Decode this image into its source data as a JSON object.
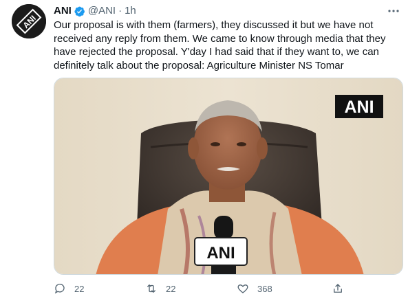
{
  "tweet": {
    "author_name": "ANI",
    "handle": "@ANI",
    "separator": "·",
    "time": "1h",
    "text": "Our proposal is with them (farmers), they discussed it but we have not received any reply from them. We came to know through media that they have rejected the proposal. Y'day I had said that if they want to, we can definitely talk about the proposal: Agriculture Minister NS Tomar",
    "verified": true,
    "avatar_logo_text": "ANI",
    "media_watermark": "ANI",
    "mic_logo": "ANI"
  },
  "actions": {
    "reply_count": "22",
    "retweet_count": "22",
    "like_count": "368"
  },
  "colors": {
    "verified_blue": "#1d9bf0",
    "secondary_text": "#536471",
    "primary_text": "#0f1419"
  },
  "icons": [
    "more-icon",
    "verified-icon",
    "reply-icon",
    "retweet-icon",
    "like-icon",
    "share-icon"
  ]
}
